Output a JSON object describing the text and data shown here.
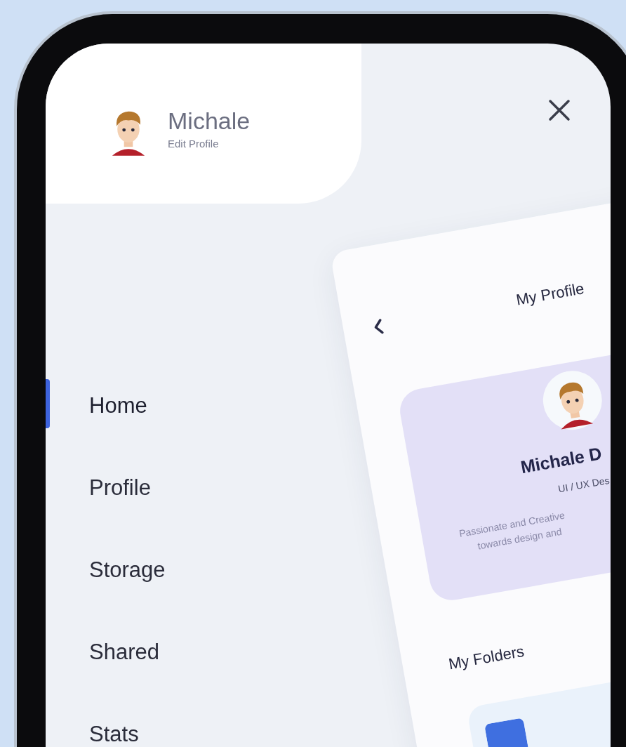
{
  "header": {
    "name": "Michale",
    "link": "Edit Profile"
  },
  "menu": [
    {
      "label": "Home",
      "selected": true
    },
    {
      "label": "Profile",
      "selected": false
    },
    {
      "label": "Storage",
      "selected": false
    },
    {
      "label": "Shared",
      "selected": false
    },
    {
      "label": "Stats",
      "selected": false
    }
  ],
  "preview": {
    "title": "My Profile",
    "name": "Michale D",
    "role": "UI / UX Des",
    "bio": [
      "Passionate and Creative",
      "towards design and"
    ],
    "section": "My Folders"
  }
}
